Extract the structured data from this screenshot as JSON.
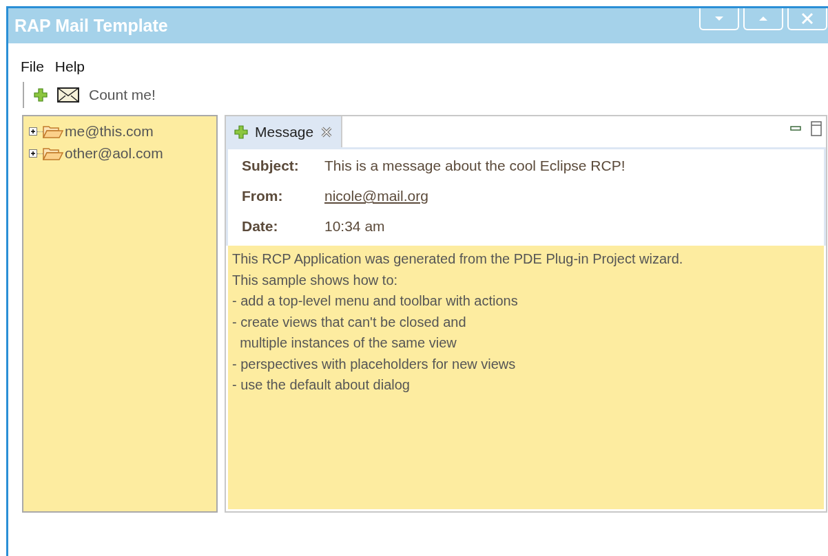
{
  "window": {
    "title": "RAP Mail Template"
  },
  "menu": [
    {
      "label": "File"
    },
    {
      "label": "Help"
    }
  ],
  "toolbar": {
    "action_label": "Count me!"
  },
  "tree": [
    {
      "label": "me@this.com",
      "expanded": false
    },
    {
      "label": "other@aol.com",
      "expanded": false
    }
  ],
  "tabs": [
    {
      "label": "Message",
      "selected": true
    }
  ],
  "message": {
    "fields": [
      {
        "label": "Subject:",
        "value": "This is a message about the cool Eclipse RCP!",
        "kind": "text"
      },
      {
        "label": "From:",
        "value": "nicole@mail.org",
        "kind": "link"
      },
      {
        "label": "Date:",
        "value": "10:34 am",
        "kind": "text"
      }
    ],
    "body": "This RCP Application was generated from the PDE Plug-in Project wizard.\nThis sample shows how to:\n- add a top-level menu and toolbar with actions\n- create views that can't be closed and\n  multiple instances of the same view\n- perspectives with placeholders for new views\n- use the default about dialog"
  }
}
